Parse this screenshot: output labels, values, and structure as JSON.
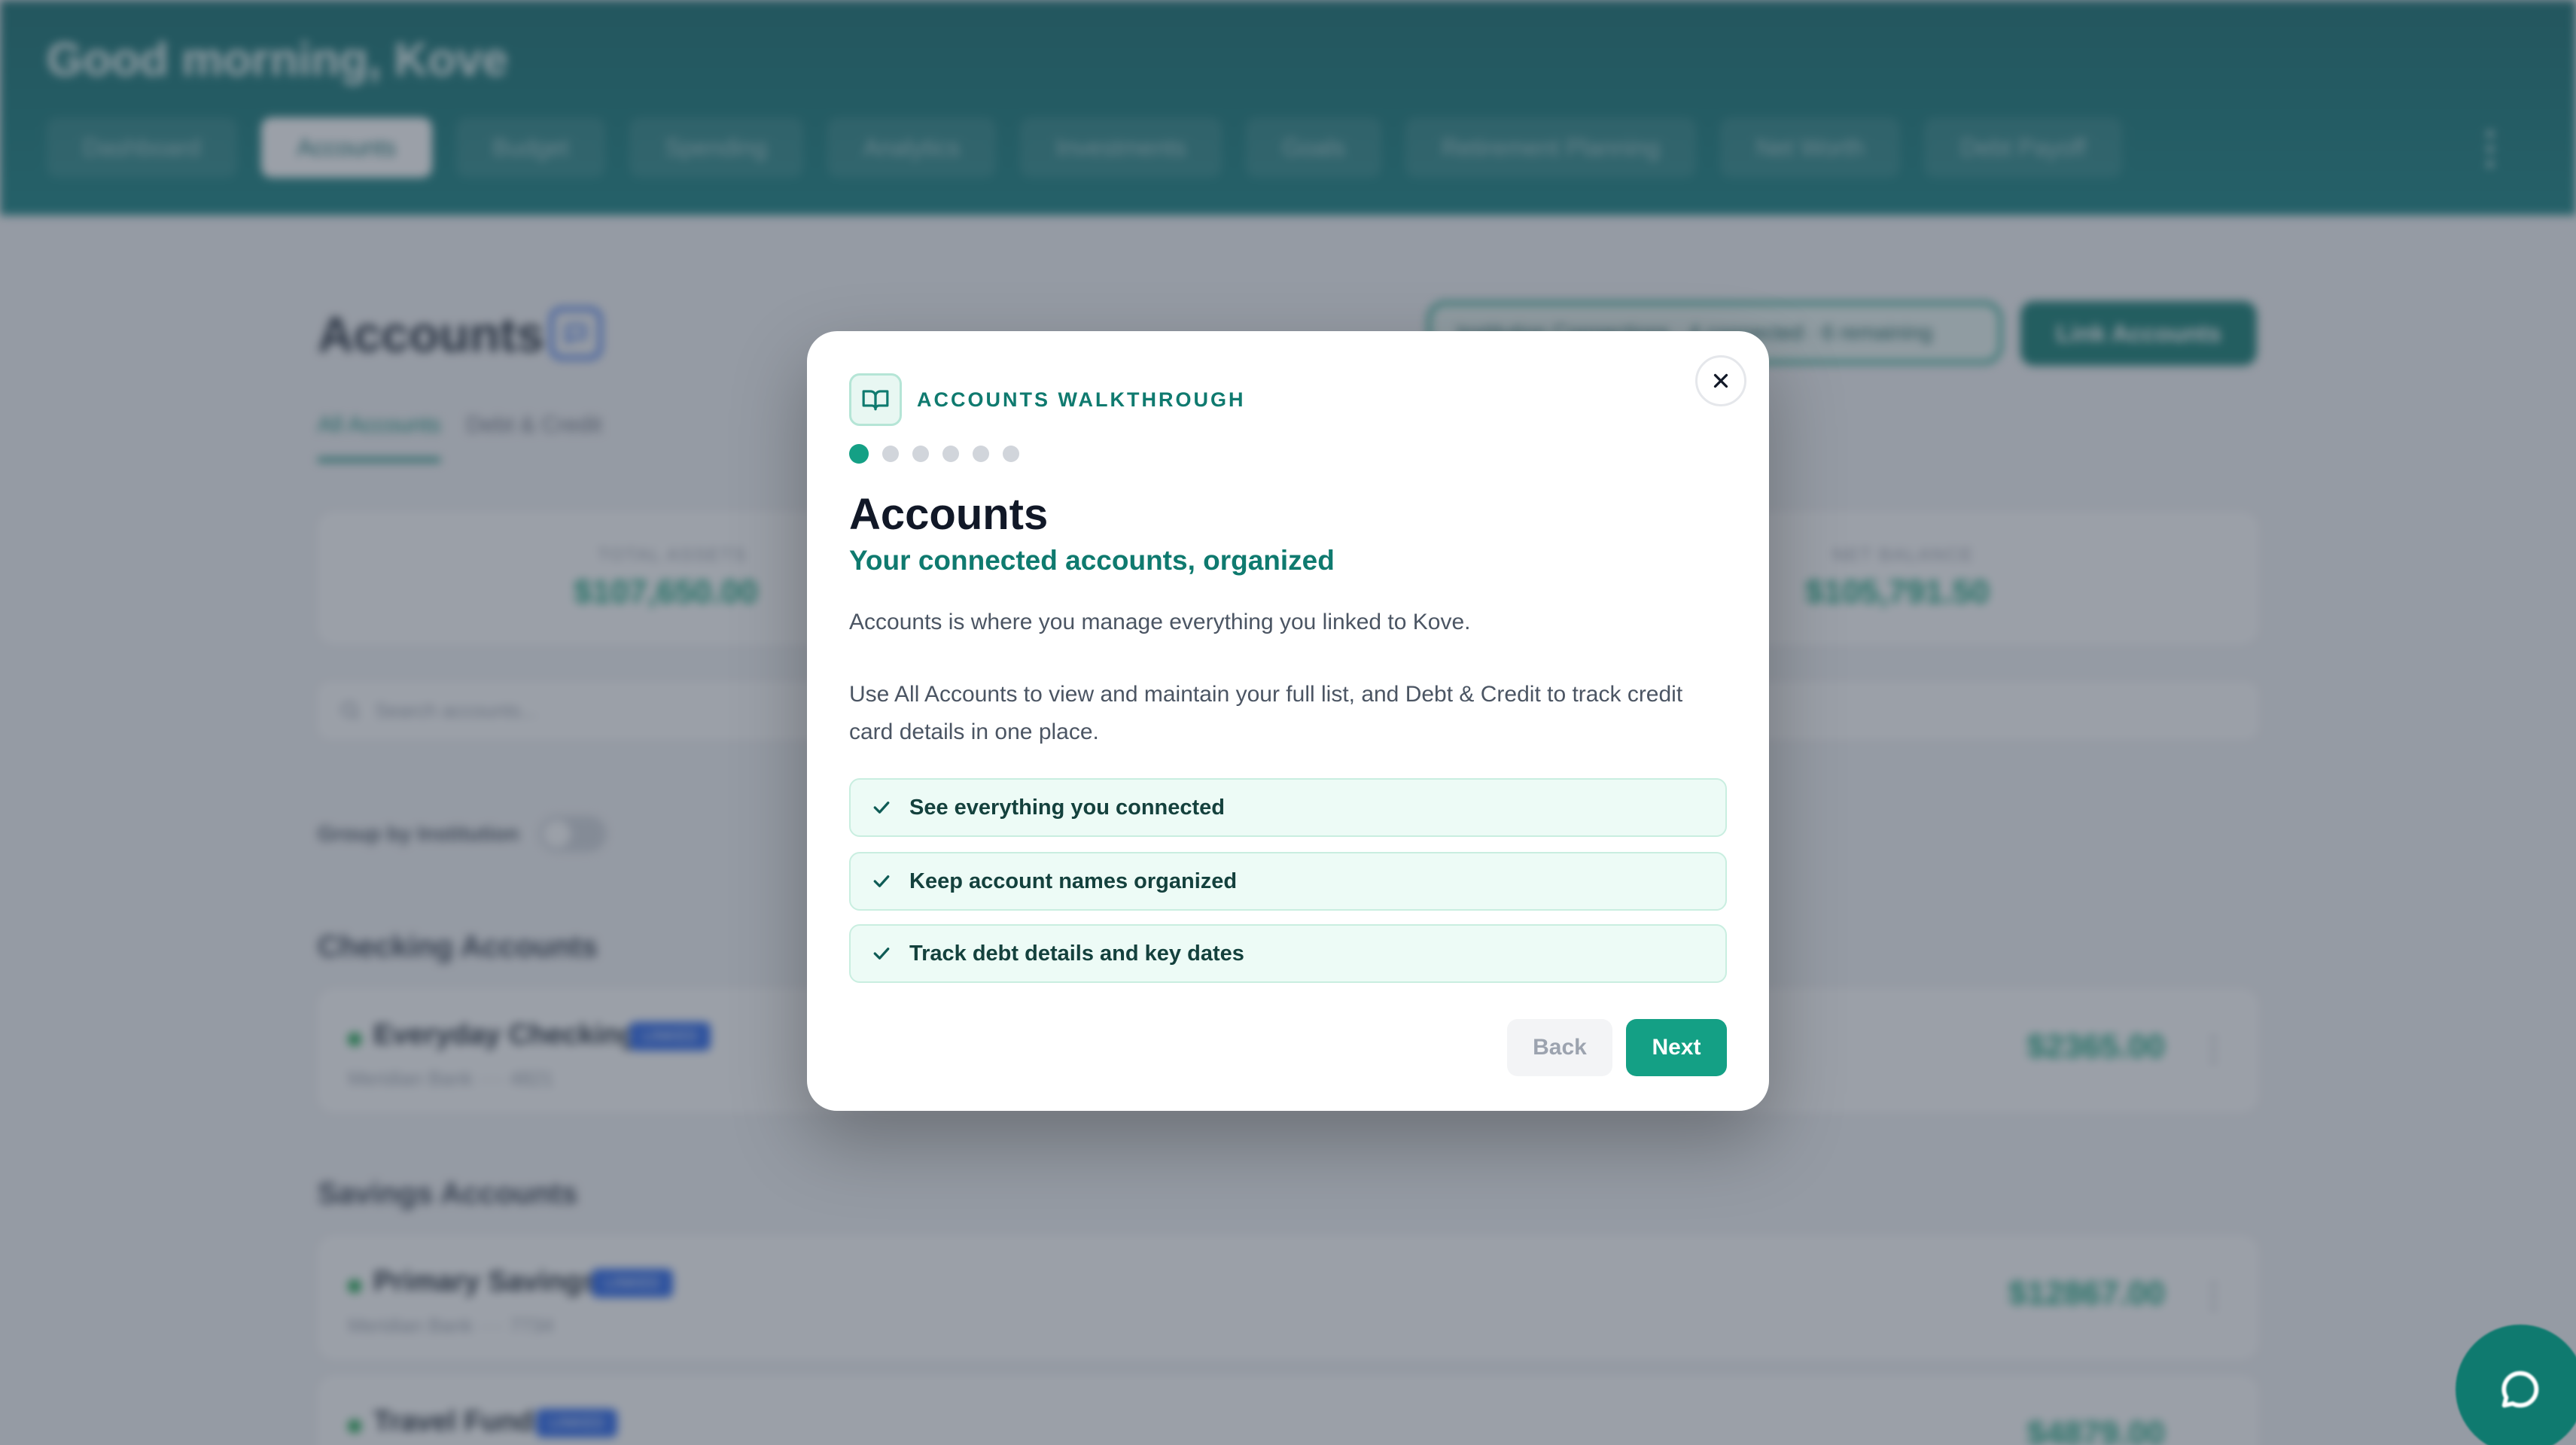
{
  "header": {
    "greeting": "Good morning, Kove",
    "nav_tabs": [
      "Dashboard",
      "Accounts",
      "Budget",
      "Spending",
      "Analytics",
      "Investments",
      "Goals",
      "Retirement Planning",
      "Net Worth",
      "Debt Payoff"
    ]
  },
  "page": {
    "title": "Accounts",
    "connections_pill": "Institution Connections · 4 connected · 6 remaining",
    "link_button": "Link Accounts",
    "sub_tabs": [
      "All Accounts",
      "Debt & Credit"
    ]
  },
  "summary": {
    "total_assets_label": "TOTAL ASSETS",
    "total_assets_value": "$107,650.00",
    "net_balance_label": "NET BALANCE",
    "net_balance_value": "$105,791.50"
  },
  "search": {
    "placeholder": "Search accounts..."
  },
  "group_toggle": {
    "label": "Group by Institution"
  },
  "sections": {
    "checking_title": "Checking Accounts",
    "savings_title": "Savings Accounts"
  },
  "accounts": [
    {
      "name": "Everyday Checking",
      "badge": "LINKED",
      "institution": "Meridian Bank  ···· 4821",
      "amount": "$2365.00"
    },
    {
      "name": "Primary Savings",
      "badge": "LINKED",
      "institution": "Meridian Bank  ···· 7734",
      "amount": "$12867.00"
    },
    {
      "name": "Travel Fund",
      "badge": "LINKED",
      "institution": "",
      "amount": "$4879.00"
    }
  ],
  "modal": {
    "label": "ACCOUNTS WALKTHROUGH",
    "title": "Accounts",
    "subtitle": "Your connected accounts, organized",
    "paragraph1": "Accounts is where you manage everything you linked to Kove.",
    "paragraph2": "Use All Accounts to view and maintain your full list, and Debt & Credit to track credit card details in one place.",
    "features": [
      "See everything you connected",
      "Keep account names organized",
      "Track debt details and key dates"
    ],
    "back_label": "Back",
    "next_label": "Next",
    "step_count": 6,
    "current_step": 1
  },
  "colors": {
    "header": "#0f6b6b",
    "accent": "#14a085",
    "accent_dark": "#0f7a6f",
    "money_green": "#17a37d",
    "badge_blue": "#2563eb"
  },
  "icons": {
    "walkthrough": "book-open-icon",
    "close": "close-icon",
    "feature": "check-icon",
    "title_help": "message-square-icon",
    "search": "search-icon",
    "chat": "message-circle-icon"
  }
}
